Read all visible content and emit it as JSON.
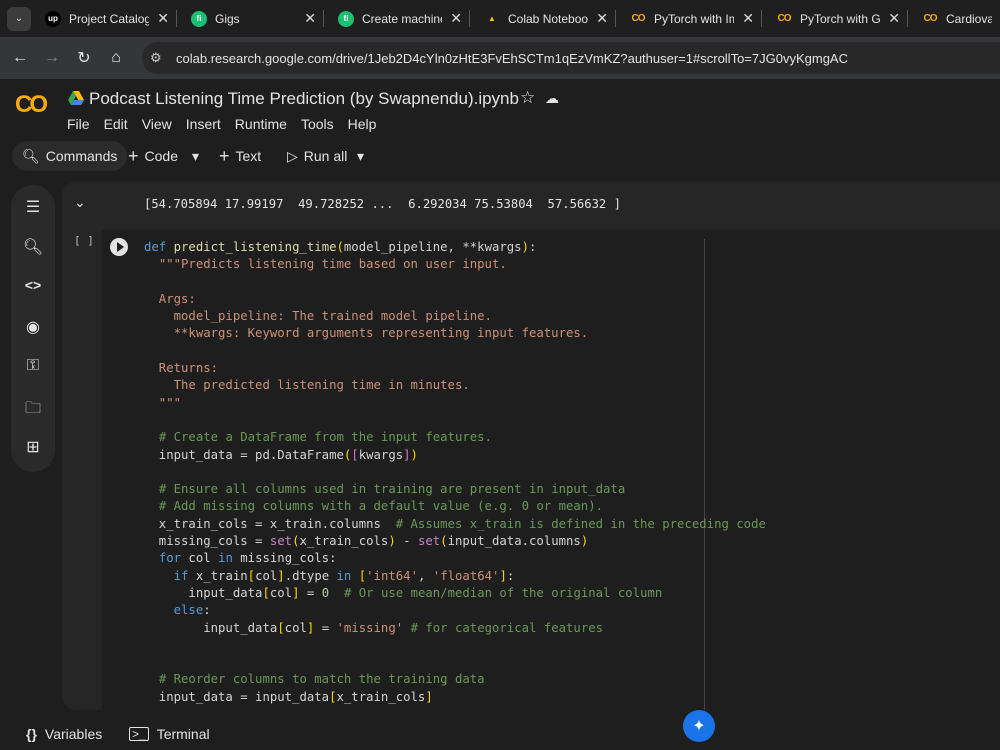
{
  "browser": {
    "tabs": [
      {
        "title": "Project Catalog |",
        "favicon": "upwork-icon",
        "fav_text": "up",
        "fav_bg": "#000000",
        "fav_fg": "#ffffff"
      },
      {
        "title": "Gigs",
        "favicon": "fiverr-icon",
        "fav_text": "fi",
        "fav_bg": "#1dbf73",
        "fav_fg": "#ffffff"
      },
      {
        "title": "Create machine l",
        "favicon": "fiverr-icon",
        "fav_text": "fi",
        "fav_bg": "#1dbf73",
        "fav_fg": "#ffffff"
      },
      {
        "title": "Colab Notebook",
        "favicon": "google-drive-icon",
        "fav_text": "▲",
        "fav_bg": "transparent",
        "fav_fg": "#fbbc04"
      },
      {
        "title": "PyTorch with Ima",
        "favicon": "colab-icon",
        "fav_text": "CO",
        "fav_bg": "transparent",
        "fav_fg": "#f9ab00"
      },
      {
        "title": "PyTorch with Gra",
        "favicon": "colab-icon",
        "fav_text": "CO",
        "fav_bg": "transparent",
        "fav_fg": "#f9ab00"
      },
      {
        "title": "Cardiovascul",
        "favicon": "colab-icon",
        "fav_text": "CO",
        "fav_bg": "transparent",
        "fav_fg": "#f9ab00"
      }
    ],
    "url": "colab.research.google.com/drive/1Jeb2D4cYln0zHtE3FvEhSCTm1qEzVmKZ?authuser=1#scrollTo=7JG0vyKgmgAC"
  },
  "colab": {
    "logo": "CO",
    "title": "Podcast Listening Time Prediction (by Swapnendu).ipynb",
    "menu": [
      "File",
      "Edit",
      "View",
      "Insert",
      "Runtime",
      "Tools",
      "Help"
    ],
    "toolbar": {
      "commands": "Commands",
      "code": "Code",
      "text": "Text",
      "run_all": "Run all"
    }
  },
  "sidebar_icons": [
    "table-of-contents-icon",
    "find-icon",
    "code-snippets-icon",
    "variables-inspector-icon",
    "secrets-key-icon",
    "files-folder-icon",
    "data-table-icon"
  ],
  "output": {
    "text": "[54.705894 17.99197  49.728252 ...  6.292034 75.53804  57.56632 ]"
  },
  "cell": {
    "exec_count": "[ ]"
  },
  "bottom": {
    "variables": "Variables",
    "terminal": "Terminal"
  },
  "colors": {
    "accent": "#f9ab00",
    "gemini": "#1a73e8"
  }
}
